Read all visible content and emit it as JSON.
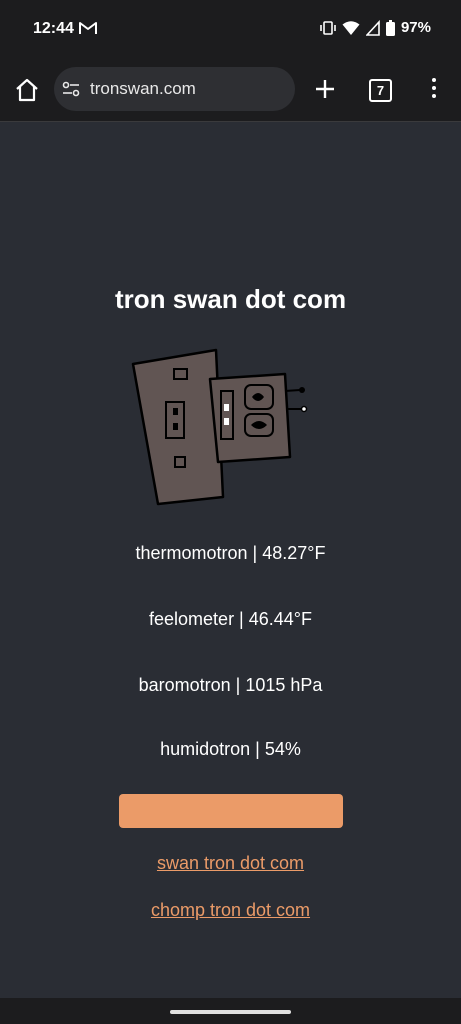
{
  "status_bar": {
    "time": "12:44",
    "battery": "97%",
    "icons": [
      "gmail-icon",
      "vibrate-icon",
      "wifi-icon",
      "signal-icon",
      "battery-icon"
    ]
  },
  "browser": {
    "url": "tronswan.com",
    "tab_count": "7",
    "icons": [
      "home-icon",
      "tune-icon",
      "plus-icon",
      "tabs-icon",
      "more-vert-icon"
    ]
  },
  "page": {
    "title": "tron swan dot com",
    "readings": [
      "thermomotron | 48.27°F",
      "feelometer | 46.44°F",
      "baromotron | 1015 hPa",
      "humidotron | 54%"
    ],
    "links": [
      "swan tron dot com",
      "chomp tron dot com"
    ],
    "accent_color": "#eb9b68",
    "background_color": "#2a2d34"
  }
}
